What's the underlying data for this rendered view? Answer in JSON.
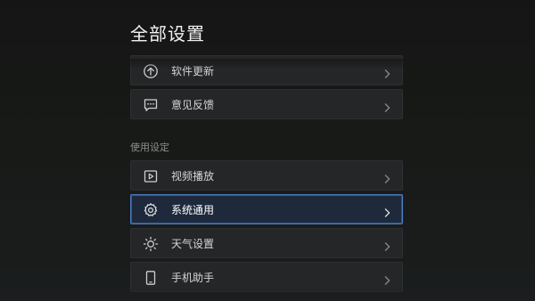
{
  "header": {
    "title": "全部设置"
  },
  "group_top": {
    "items": [
      {
        "label": "软件更新",
        "icon": "upload-arrow-icon"
      },
      {
        "label": "意见反馈",
        "icon": "feedback-chat-icon"
      }
    ]
  },
  "usage_section": {
    "title": "使用设定",
    "items": [
      {
        "label": "视频播放",
        "icon": "video-play-icon"
      },
      {
        "label": "系统通用",
        "icon": "gear-icon",
        "selected": true
      },
      {
        "label": "天气设置",
        "icon": "sun-icon"
      },
      {
        "label": "手机助手",
        "icon": "phone-icon"
      }
    ]
  },
  "colors": {
    "selected_border": "#4b78b8",
    "selected_background": "#1e2a3c",
    "row_background": "#252628"
  }
}
